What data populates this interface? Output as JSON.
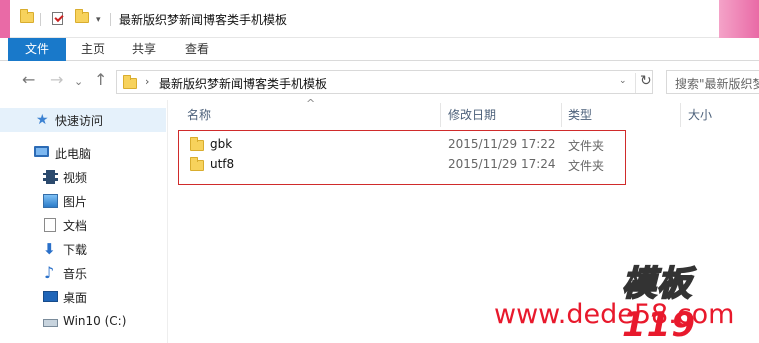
{
  "window": {
    "title": "最新版织梦新闻博客类手机模板",
    "quick_access_dropdown": "▾"
  },
  "ribbon": {
    "tabs": [
      {
        "label": "文件",
        "active": true
      },
      {
        "label": "主页"
      },
      {
        "label": "共享"
      },
      {
        "label": "查看"
      }
    ]
  },
  "nav": {
    "back": "←",
    "forward": "→",
    "recent": "⌄",
    "up": "↑",
    "address": {
      "separator": "›",
      "path": "最新版织梦新闻博客类手机模板",
      "dropdown": "⌄",
      "refresh": "↻"
    },
    "search_placeholder": "搜索\"最新版织梦"
  },
  "sidebar": {
    "items": [
      {
        "label": "快速访问",
        "icon": "star-icon",
        "selected": true
      },
      {
        "label": "此电脑",
        "icon": "computer-icon"
      },
      {
        "label": "视频",
        "icon": "video-icon"
      },
      {
        "label": "图片",
        "icon": "pictures-icon"
      },
      {
        "label": "文档",
        "icon": "documents-icon"
      },
      {
        "label": "下载",
        "icon": "download-icon"
      },
      {
        "label": "音乐",
        "icon": "music-icon"
      },
      {
        "label": "桌面",
        "icon": "desktop-icon"
      },
      {
        "label": "Win10 (C:)",
        "icon": "drive-icon"
      }
    ]
  },
  "columns": {
    "name": "名称",
    "modified": "修改日期",
    "type": "类型",
    "size": "大小",
    "sort_indicator": "^"
  },
  "files": [
    {
      "name": "gbk",
      "modified": "2015/11/29 17:22",
      "type": "文件夹"
    },
    {
      "name": "utf8",
      "modified": "2015/11/29 17:24",
      "type": "文件夹"
    }
  ],
  "watermark": {
    "logo_a": "模板",
    "logo_b": "119",
    "url": "www.dede58.com"
  },
  "colors": {
    "accent": "#1979ca",
    "highlight_border": "#d02b2b",
    "watermark_red": "#e8192c"
  }
}
